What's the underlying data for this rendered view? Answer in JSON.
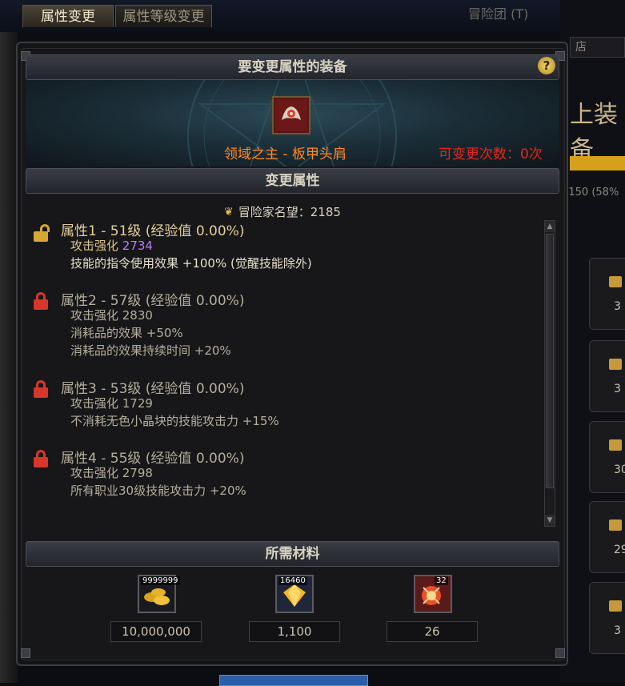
{
  "tabs": {
    "active": "属性变更",
    "inactive": "属性等级变更"
  },
  "background": {
    "adventure_group": "冒险团 (T)",
    "shop": "店",
    "equip_fragment": "上装备",
    "progress_fragment": "/150 (58%",
    "side_cards": [
      "3",
      "3",
      "30",
      "29",
      "3"
    ]
  },
  "equipment_section": {
    "title": "要变更属性的装备",
    "help": "?",
    "item_name": "领域之主 - 板甲头肩",
    "change_count_label": "可变更次数：0次"
  },
  "attribute_section": {
    "title": "变更属性",
    "fame_label": "冒险家名望：2185",
    "attributes": [
      {
        "title": "属性1 - 51级 (经验值 0.00%)",
        "lock": "unlocked",
        "lines": [
          {
            "label": "攻击强化 ",
            "value": "2734"
          },
          {
            "label": "技能的指令使用效果 +100% (觉醒技能除外)"
          }
        ]
      },
      {
        "title": "属性2 - 57级 (经验值 0.00%)",
        "lock": "locked",
        "lines": [
          {
            "label": "攻击强化 2830"
          },
          {
            "label": "消耗品的效果 +50%"
          },
          {
            "label": "消耗品的效果持续时间 +20%"
          }
        ]
      },
      {
        "title": "属性3 - 53级 (经验值 0.00%)",
        "lock": "locked",
        "lines": [
          {
            "label": "攻击强化 1729"
          },
          {
            "label": "不消耗无色小晶块的技能攻击力 +15%"
          }
        ]
      },
      {
        "title": "属性4 - 55级 (经验值 0.00%)",
        "lock": "locked",
        "lines": [
          {
            "label": "攻击强化 2798"
          },
          {
            "label": "所有职业30级技能攻击力 +20%"
          }
        ]
      }
    ]
  },
  "materials_section": {
    "title": "所需材料",
    "items": [
      {
        "icon": "gold-coins-icon",
        "badge": "9999999",
        "amount": "10,000,000"
      },
      {
        "icon": "gem-icon",
        "badge": "16460",
        "amount": "1,100"
      },
      {
        "icon": "energy-burst-icon",
        "badge": "32",
        "amount": "26"
      }
    ]
  },
  "colors": {
    "item_name": "#ff8a22",
    "change_count": "#e2281e",
    "highlight_value": "#b57bff",
    "unlocked": "#d6a830",
    "locked": "#d8362a"
  }
}
